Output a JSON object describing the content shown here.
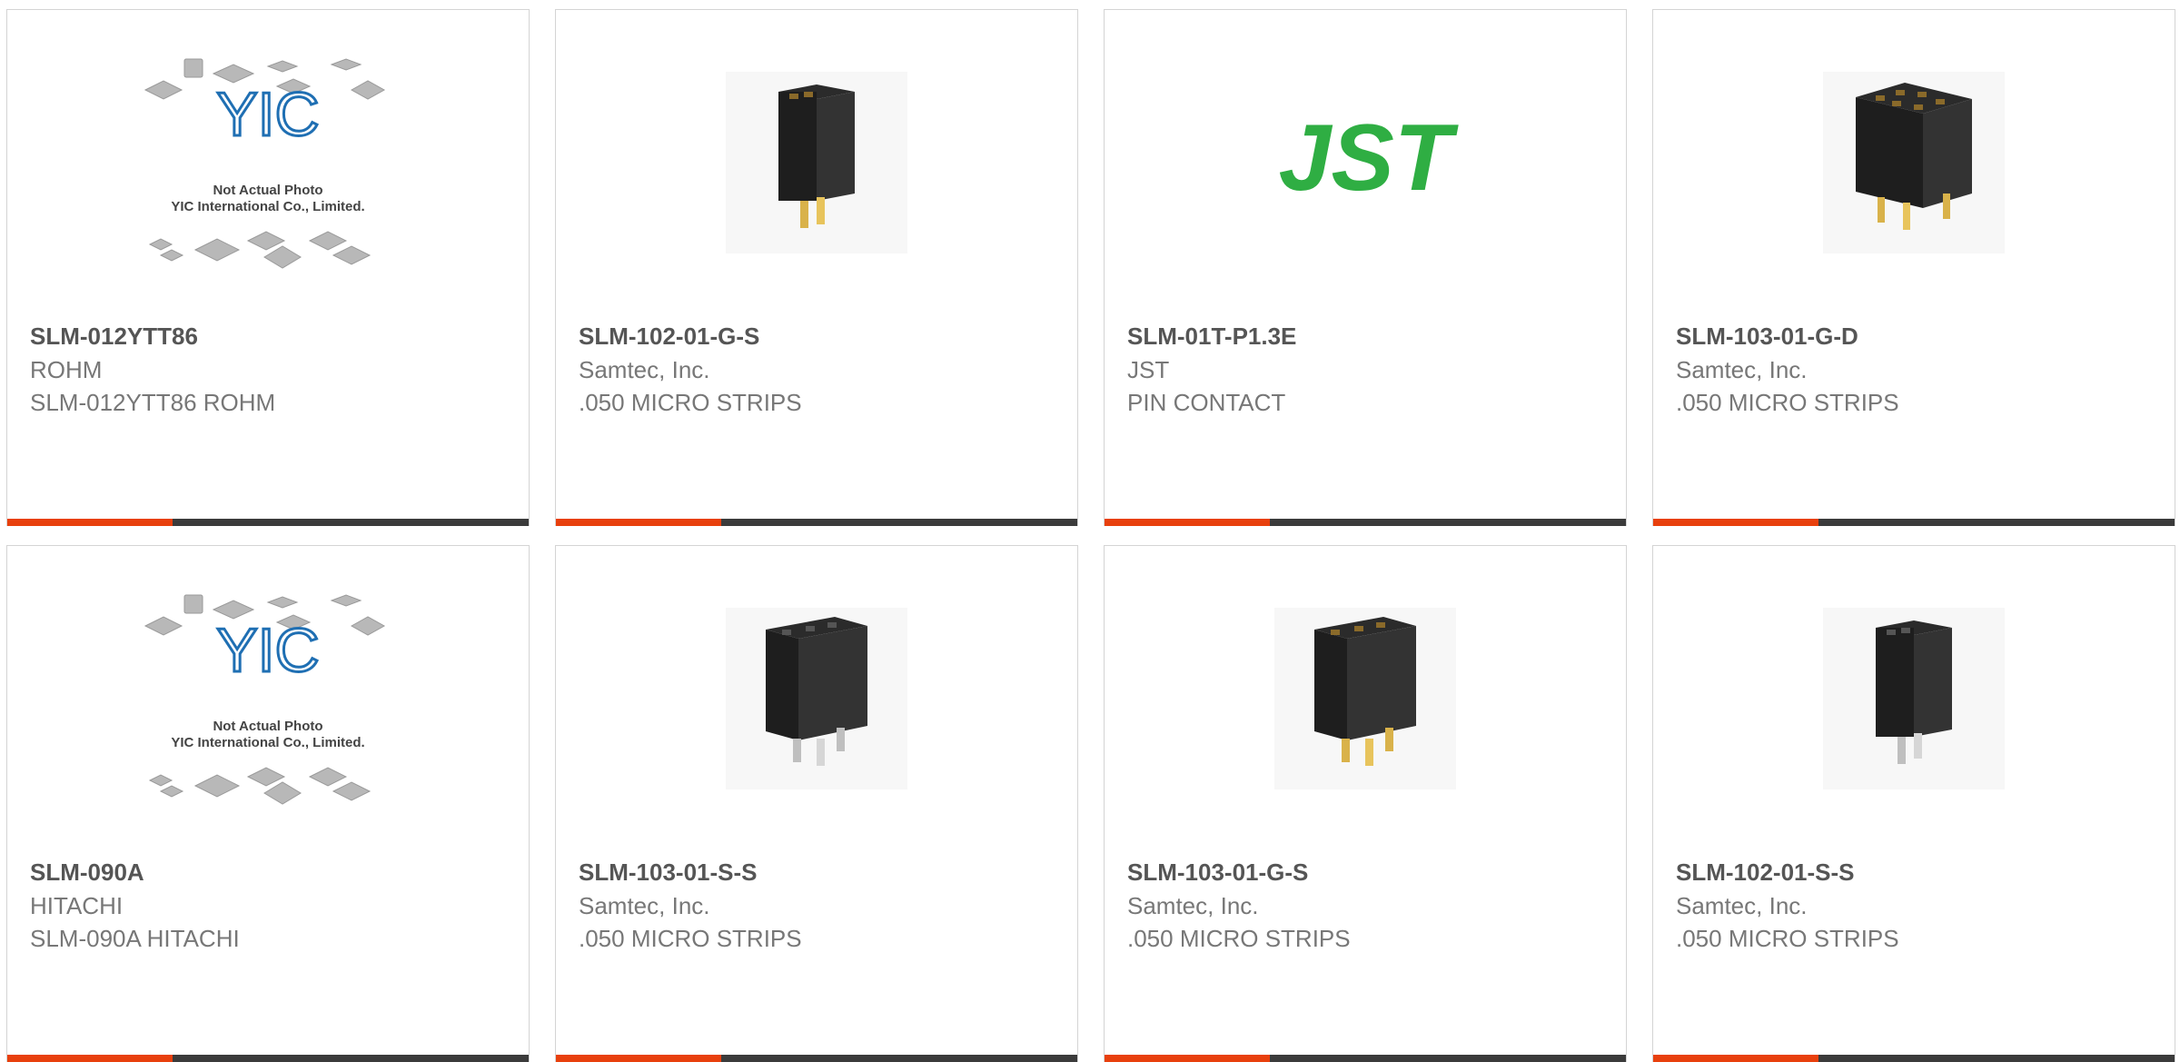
{
  "colors": {
    "accent": "#e8400d",
    "bar": "#3b3b3b",
    "card_border": "#d4d4d4",
    "jst_green": "#2fae43",
    "yic_blue": "#1f6fb3"
  },
  "products": [
    {
      "part_number": "SLM-012YTT86",
      "manufacturer": "ROHM",
      "description": "SLM-012YTT86 ROHM",
      "image": "placeholder-yic",
      "image_caption_1": "Not Actual Photo",
      "image_caption_2": "YIC International Co., Limited.",
      "image_logo": "YIC"
    },
    {
      "part_number": "SLM-102-01-G-S",
      "manufacturer": "Samtec, Inc.",
      "description": ".050 MICRO STRIPS",
      "image": "connector-2pin-gold"
    },
    {
      "part_number": "SLM-01T-P1.3E",
      "manufacturer": "JST",
      "description": "PIN CONTACT",
      "image": "jst-logo",
      "image_logo": "JST"
    },
    {
      "part_number": "SLM-103-01-G-D",
      "manufacturer": "Samtec, Inc.",
      "description": ".050 MICRO STRIPS",
      "image": "connector-6pin-gold"
    },
    {
      "part_number": "SLM-090A",
      "manufacturer": "HITACHI",
      "description": "SLM-090A HITACHI",
      "image": "placeholder-yic",
      "image_caption_1": "Not Actual Photo",
      "image_caption_2": "YIC International Co., Limited.",
      "image_logo": "YIC"
    },
    {
      "part_number": "SLM-103-01-S-S",
      "manufacturer": "Samtec, Inc.",
      "description": ".050 MICRO STRIPS",
      "image": "connector-3pin-silver"
    },
    {
      "part_number": "SLM-103-01-G-S",
      "manufacturer": "Samtec, Inc.",
      "description": ".050 MICRO STRIPS",
      "image": "connector-3pin-gold"
    },
    {
      "part_number": "SLM-102-01-S-S",
      "manufacturer": "Samtec, Inc.",
      "description": ".050 MICRO STRIPS",
      "image": "connector-2pin-silver"
    }
  ]
}
